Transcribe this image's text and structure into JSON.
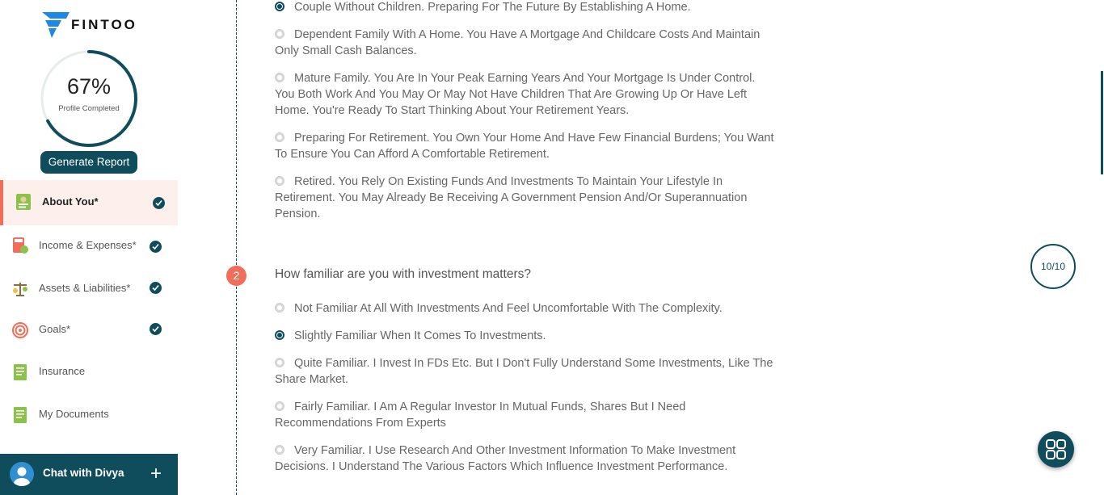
{
  "brand": {
    "name": "FINTOO",
    "logo_color": "#1e88e5"
  },
  "profile": {
    "percent": "67%",
    "percent_value": 0.67,
    "label": "Profile Completed",
    "generate_button": "Generate Report"
  },
  "nav": [
    {
      "label": "About You*",
      "icon": "profile-card-icon",
      "done": true,
      "active": true
    },
    {
      "label": "Income & Expenses*",
      "icon": "calculator-icon",
      "done": true,
      "active": false
    },
    {
      "label": "Assets & Liabilities*",
      "icon": "scale-icon",
      "done": true,
      "active": false
    },
    {
      "label": "Goals*",
      "icon": "target-icon",
      "done": true,
      "active": false
    },
    {
      "label": "Insurance",
      "icon": "document-icon",
      "done": false,
      "active": false
    },
    {
      "label": "My Documents",
      "icon": "document-icon",
      "done": false,
      "active": false
    }
  ],
  "chat": {
    "label": "Chat with Divya",
    "plus": "+"
  },
  "question1_options": [
    {
      "text": "Couple Without Children. Preparing For The Future By Establishing A Home.",
      "selected": true
    },
    {
      "text": "Dependent Family With A Home. You Have A Mortgage And Childcare Costs And Maintain Only Small Cash Balances.",
      "selected": false
    },
    {
      "text": "Mature Family. You Are In Your Peak Earning Years And Your Mortgage Is Under Control. You Both Work And You May Or May Not Have Children That Are Growing Up Or Have Left Home. You're Ready To Start Thinking About Your Retirement Years.",
      "selected": false
    },
    {
      "text": "Preparing For Retirement. You Own Your Home And Have Few Financial Burdens; You Want To Ensure You Can Afford A Comfortable Retirement.",
      "selected": false
    },
    {
      "text": "Retired. You Rely On Existing Funds And Investments To Maintain Your Lifestyle In Retirement. You May Already Be Receiving A Government Pension And/Or Superannuation Pension.",
      "selected": false
    }
  ],
  "question2": {
    "number": "2",
    "text": "How familiar are you with investment matters?",
    "options": [
      {
        "text": "Not Familiar At All With Investments And Feel Uncomfortable With The Complexity.",
        "selected": false
      },
      {
        "text": "Slightly Familiar When It Comes To Investments.",
        "selected": true
      },
      {
        "text": "Quite Familiar. I Invest In FDs Etc. But I Don't Fully Understand Some Investments, Like The Share Market.",
        "selected": false
      },
      {
        "text": "Fairly Familiar. I Am A Regular Investor In Mutual Funds, Shares But I Need Recommendations From Experts",
        "selected": false
      },
      {
        "text": "Very Familiar. I Use Research And Other Investment Information To Make Investment Decisions. I Understand The Various Factors Which Influence Investment Performance.",
        "selected": false
      }
    ]
  },
  "progress": {
    "label": "10/10"
  },
  "colors": {
    "primary": "#0f4c5c",
    "accent": "#f06e5a",
    "active_bg": "#fdf0ec"
  }
}
